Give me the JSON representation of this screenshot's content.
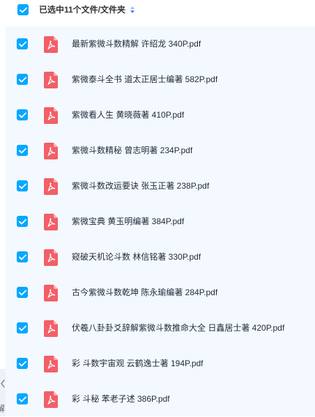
{
  "header": {
    "select_all_checked": true,
    "selection_label": "已选中11个文件/文件夹",
    "sort_icon": "sort-toggle-icon"
  },
  "colors": {
    "accent": "#06a7ff",
    "pdf_icon": "#f25f67",
    "list_background": "#f4f9ff"
  },
  "files": [
    {
      "name": "最新紫微斗数精解 许绍龙 340P.pdf",
      "checked": true,
      "icon": "pdf-icon"
    },
    {
      "name": "紫微泰斗全书 道太正居士编著 582P.pdf",
      "checked": true,
      "icon": "pdf-icon"
    },
    {
      "name": "紫微看人生 黄晓薇著 410P.pdf",
      "checked": true,
      "icon": "pdf-icon"
    },
    {
      "name": "紫微斗数精秘 曾志明著 234P.pdf",
      "checked": true,
      "icon": "pdf-icon"
    },
    {
      "name": "紫微斗数改运要诀 张玉正著 238P.pdf",
      "checked": true,
      "icon": "pdf-icon"
    },
    {
      "name": "紫微宝典 黄玉明编著 384P.pdf",
      "checked": true,
      "icon": "pdf-icon"
    },
    {
      "name": "窥破天机论斗数 林信铭著 330P.pdf",
      "checked": true,
      "icon": "pdf-icon"
    },
    {
      "name": "古今紫微斗数乾坤 陈永瑜编著 284P.pdf",
      "checked": true,
      "icon": "pdf-icon"
    },
    {
      "name": "伏羲八卦卦爻辞解紫微斗数推命大全 日鑫居士著 420P.pdf",
      "checked": true,
      "icon": "pdf-icon"
    },
    {
      "name": "彩 斗数宇宙观 云鹤逸士著 194P.pdf",
      "checked": true,
      "icon": "pdf-icon"
    },
    {
      "name": "彩 斗秘 苯老子述 386P.pdf",
      "checked": true,
      "icon": "pdf-icon"
    }
  ],
  "side_panel": {
    "collapse_icon": "chevron-left-icon",
    "text": "解"
  }
}
